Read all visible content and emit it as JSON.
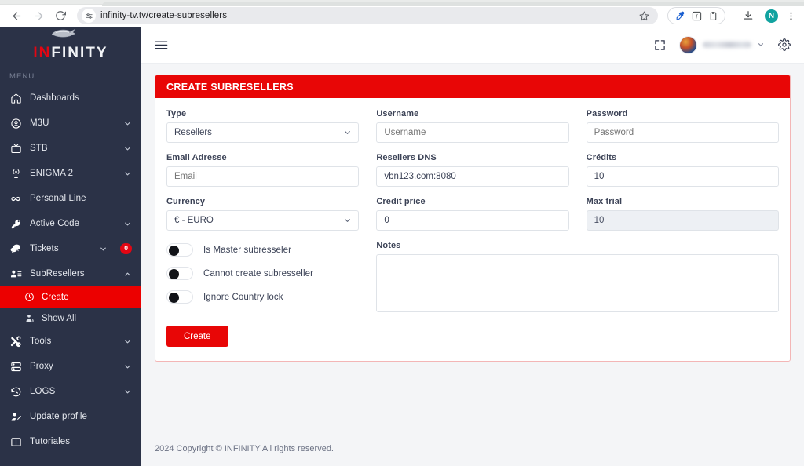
{
  "browser": {
    "url": "infinity-tv.tv/create-subresellers",
    "back_label": "Back",
    "forward_label": "Forward",
    "reload_label": "Reload",
    "bookmark_label": "Bookmark this tab",
    "downloads_label": "Downloads",
    "menu_label": "Customize and control Chrome",
    "profile_initial": "N",
    "extensions": [
      "eyedropper-icon",
      "font-icon",
      "clipboard-icon"
    ]
  },
  "sidebar": {
    "brand": {
      "part1": "IN",
      "part2": "FINITY"
    },
    "menu_heading": "MENU",
    "items": [
      {
        "label": "Dashboards",
        "icon": "home-icon",
        "caret": false,
        "badge": null,
        "active": false
      },
      {
        "label": "M3U",
        "icon": "user-circle-icon",
        "caret": true,
        "badge": null,
        "active": false
      },
      {
        "label": "STB",
        "icon": "tv-icon",
        "caret": true,
        "badge": null,
        "active": false
      },
      {
        "label": "ENIGMA 2",
        "icon": "broadcast-icon",
        "caret": true,
        "badge": null,
        "active": false
      },
      {
        "label": "Personal Line",
        "icon": "infinity-icon",
        "caret": false,
        "badge": null,
        "active": false
      },
      {
        "label": "Active Code",
        "icon": "key-icon",
        "caret": true,
        "badge": null,
        "active": false
      },
      {
        "label": "Tickets",
        "icon": "chat-icon",
        "caret": true,
        "badge": "0",
        "active": false
      },
      {
        "label": "SubResellers",
        "icon": "user-list-icon",
        "caret": true,
        "badge": null,
        "active": false,
        "expanded": true
      }
    ],
    "subitems": [
      {
        "label": "Create",
        "icon": "clock-icon",
        "active": true
      },
      {
        "label": "Show All",
        "icon": "people-icon",
        "active": false
      }
    ],
    "items_after": [
      {
        "label": "Tools",
        "icon": "tools-icon",
        "caret": true,
        "badge": null,
        "active": false
      },
      {
        "label": "Proxy",
        "icon": "server-icon",
        "caret": true,
        "badge": null,
        "active": false
      },
      {
        "label": "LOGS",
        "icon": "history-icon",
        "caret": true,
        "badge": null,
        "active": false
      },
      {
        "label": "Update profile",
        "icon": "user-edit-icon",
        "caret": false,
        "badge": null,
        "active": false
      },
      {
        "label": "Tutoriales",
        "icon": "book-icon",
        "caret": false,
        "badge": null,
        "active": false
      }
    ]
  },
  "topbar": {
    "menu_toggle": "hamburger-icon",
    "fullscreen_label": "fullscreen-icon",
    "settings_label": "gear-icon",
    "user_name": ""
  },
  "card": {
    "title": "CREATE SUBRESELLERS"
  },
  "form": {
    "type": {
      "label": "Type",
      "value": "Resellers"
    },
    "username": {
      "label": "Username",
      "value": "",
      "placeholder": "Username"
    },
    "password": {
      "label": "Password",
      "value": "",
      "placeholder": "Password"
    },
    "email": {
      "label": "Email Adresse",
      "value": "",
      "placeholder": "Email"
    },
    "dns": {
      "label": "Resellers DNS",
      "value": "vbn123.com:8080"
    },
    "credits": {
      "label": "Crédits",
      "value": "10"
    },
    "currency": {
      "label": "Currency",
      "value": "€ - EURO"
    },
    "credit_price": {
      "label": "Credit price",
      "value": "0"
    },
    "max_trial": {
      "label": "Max trial",
      "value": "10",
      "disabled": true
    },
    "notes": {
      "label": "Notes",
      "value": ""
    },
    "toggles": [
      {
        "label": "Is Master subresseler",
        "on": false
      },
      {
        "label": "Cannot create subresseller",
        "on": false
      },
      {
        "label": "Ignore Country lock",
        "on": false
      }
    ],
    "submit_label": "Create"
  },
  "footer": {
    "copyright": "2024 Copyright © INFINITY All rights reserved."
  },
  "colors": {
    "brand_red": "#e80606",
    "sidebar_bg": "#2b3247",
    "page_bg": "#f4f5f7",
    "badge_red": "#e30613"
  }
}
